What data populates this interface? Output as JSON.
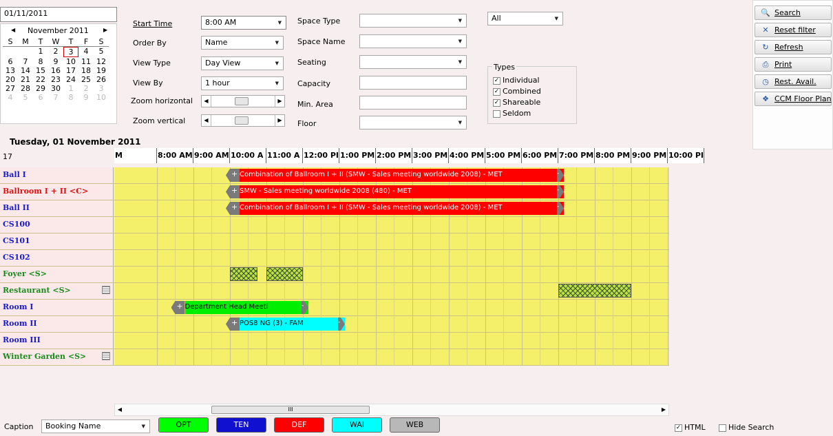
{
  "date_field": "01/11/2011",
  "calendar": {
    "month": "November 2011",
    "weekdays": [
      "S",
      "M",
      "T",
      "W",
      "T",
      "F",
      "S"
    ],
    "weeks": [
      [
        "",
        "",
        "1",
        "2",
        "3",
        "4",
        "5"
      ],
      [
        "6",
        "7",
        "8",
        "9",
        "10",
        "11",
        "12"
      ],
      [
        "13",
        "14",
        "15",
        "16",
        "17",
        "18",
        "19"
      ],
      [
        "20",
        "21",
        "22",
        "23",
        "24",
        "25",
        "26"
      ],
      [
        "27",
        "28",
        "29",
        "30",
        "1",
        "2",
        "3"
      ],
      [
        "4",
        "5",
        "6",
        "7",
        "8",
        "9",
        "10"
      ]
    ],
    "selected_day": "3"
  },
  "filters": {
    "start_time": {
      "label": "Start Time",
      "value": "8:00 AM"
    },
    "order_by": {
      "label": "Order By",
      "value": "Name"
    },
    "view_type": {
      "label": "View Type",
      "value": "Day View"
    },
    "view_by": {
      "label": "View By",
      "value": "1 hour"
    },
    "zoom_horizontal": {
      "label": "Zoom horizontal",
      "level": 0.5
    },
    "zoom_vertical": {
      "label": "Zoom vertical",
      "level": 0.5
    },
    "space_type": {
      "label": "Space Type",
      "value": ""
    },
    "space_name": {
      "label": "Space Name",
      "value": ""
    },
    "seating": {
      "label": "Seating",
      "value": ""
    },
    "capacity": {
      "label": "Capacity",
      "value": ""
    },
    "min_area": {
      "label": "Min. Area",
      "value": ""
    },
    "floor": {
      "label": "Floor",
      "value": ""
    },
    "all_select": "All",
    "types": {
      "title": "Types",
      "items": [
        {
          "label": "Individual",
          "checked": true
        },
        {
          "label": "Combined",
          "checked": true
        },
        {
          "label": "Shareable",
          "checked": true
        },
        {
          "label": "Seldom",
          "checked": false
        }
      ]
    }
  },
  "toolbar": [
    {
      "label": "Search",
      "icon": "magnifier-icon"
    },
    {
      "label": "Reset filter",
      "icon": "reset-filter-icon"
    },
    {
      "label": "Refresh",
      "icon": "refresh-icon"
    },
    {
      "label": "Print",
      "icon": "printer-icon"
    },
    {
      "label": "Rest. Avail.",
      "icon": "clock-icon"
    },
    {
      "label": "CCM Floor Plan",
      "icon": "floor-plan-icon"
    }
  ],
  "schedule": {
    "date_title": "Tuesday, 01 November 2011",
    "corner_label": "17",
    "hours": [
      "M",
      "8:00 AM",
      "9:00 AM",
      "10:00 A",
      "11:00 A",
      "12:00 PI",
      "1:00 PM",
      "2:00 PM",
      "3:00 PM",
      "4:00 PM",
      "5:00 PM",
      "6:00 PM",
      "7:00 PM",
      "8:00 PM",
      "9:00 PM",
      "10:00 PI"
    ],
    "rooms": [
      {
        "label": "Ball I",
        "color": "#1a1ad0"
      },
      {
        "label": "Ballroom I + II  <C>",
        "color": "#e01010"
      },
      {
        "label": "Ball II",
        "color": "#1a1ad0"
      },
      {
        "label": "CS100",
        "color": "#1a1ad0"
      },
      {
        "label": "CS101",
        "color": "#1a1ad0"
      },
      {
        "label": "CS102",
        "color": "#1a1ad0"
      },
      {
        "label": "Foyer  <S>",
        "color": "#1a8a1a"
      },
      {
        "label": "Restaurant  <S>",
        "color": "#1a8a1a"
      },
      {
        "label": "Room I",
        "color": "#1a1ad0"
      },
      {
        "label": "Room II",
        "color": "#1a1ad0"
      },
      {
        "label": "Room III",
        "color": "#1a1ad0"
      },
      {
        "label": "Winter Garden  <S>",
        "color": "#1a8a1a"
      }
    ],
    "bookings": [
      {
        "text": "Combination of Ballroom I + II (SMW - Sales meeting worldwide 2008) - MET",
        "color": "#ff0000",
        "start": "10:00",
        "end": "19:00",
        "row": 0
      },
      {
        "text": "SMW - Sales meeting worldwide 2008 (480) - MET",
        "color": "#ff0000",
        "start": "10:00",
        "end": "19:00",
        "row": 1
      },
      {
        "text": "Combination of Ballroom I + II (SMW - Sales meeting worldwide 2008) - MET",
        "color": "#ff0000",
        "start": "10:00",
        "end": "19:00",
        "row": 2
      },
      {
        "text": "Department Head Meeti",
        "color": "#00ee00",
        "start": "8:30",
        "end": "12:00",
        "row": 8
      },
      {
        "text": "POS8 NG (3) - FAM",
        "color": "#00ffff",
        "start": "10:00",
        "end": "13:00",
        "row": 9
      }
    ],
    "blocks": [
      {
        "row": 6,
        "start": "10:00",
        "end": "10:45"
      },
      {
        "row": 6,
        "start": "11:00",
        "end": "12:00"
      },
      {
        "row": 7,
        "start": "19:00",
        "end": "21:00"
      }
    ]
  },
  "scrollbar": {
    "thumb_label": "III"
  },
  "caption": {
    "label": "Caption",
    "value": "Booking Name",
    "legend": [
      {
        "label": "OPT",
        "color": "#00ff00",
        "text": "#000"
      },
      {
        "label": "TEN",
        "color": "#1010d0",
        "text": "#fff"
      },
      {
        "label": "DEF",
        "color": "#ff0000",
        "text": "#fff"
      },
      {
        "label": "WAI",
        "color": "#00ffff",
        "text": "#000"
      },
      {
        "label": "WEB",
        "color": "#b8b8b8",
        "text": "#000"
      }
    ]
  },
  "options": {
    "html": {
      "label": "HTML",
      "checked": true
    },
    "hide_search": {
      "label": "Hide Search",
      "checked": false
    }
  }
}
